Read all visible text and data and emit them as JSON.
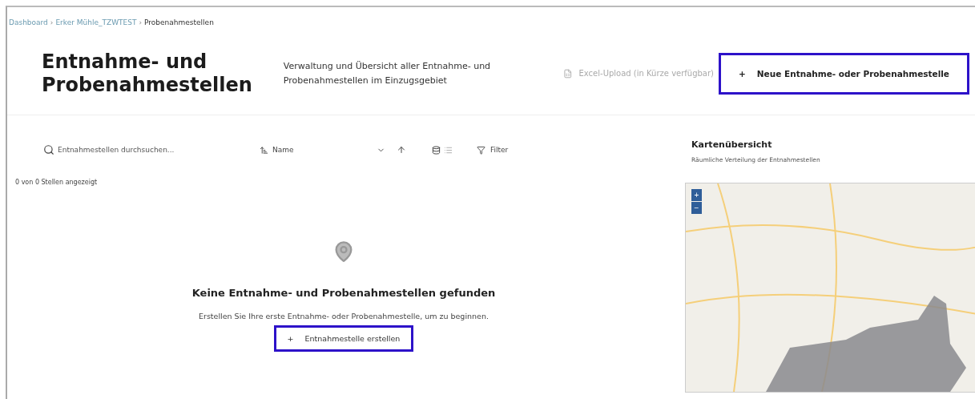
{
  "breadcrumb": {
    "separator": "›",
    "items": [
      {
        "label": "Dashboard",
        "kind": "link"
      },
      {
        "label": "Erker Mühle_TZWTEST",
        "kind": "link"
      },
      {
        "label": "Probenahmestellen",
        "kind": "current"
      }
    ]
  },
  "header": {
    "title": "Entnahme- und Probenahmestellen",
    "description": "Verwaltung und Übersicht aller Entnahme- und Probenahmestellen im Einzugsgebiet",
    "excel_upload": {
      "label": "Excel-Upload (in Kürze verfügbar)",
      "disabled": true
    },
    "new_button": {
      "icon": "+",
      "label": "Neue Entnahme- oder Probenahmestelle"
    }
  },
  "toolbar": {
    "search": {
      "placeholder": "Entnahmestellen durchsuchen..."
    },
    "sort": {
      "value": "Name"
    },
    "views": [
      {
        "kind": "grid",
        "selected": true
      },
      {
        "kind": "list",
        "selected": false
      }
    ],
    "filter": "Filter"
  },
  "count": "0 von 0 Stellen angezeigt",
  "empty": {
    "title": "Keine Entnahme- und Probenahmestellen gefunden",
    "text": "Erstellen Sie Ihre erste Entnahme- oder Probenahmestelle, um zu beginnen.",
    "button": {
      "icon": "+",
      "label": "Entnahmestelle erstellen"
    }
  },
  "map": {
    "title": "Kartenübersicht",
    "subtitle": "Räumliche Verteilung der Entnahmestellen",
    "zoom_in": "+",
    "zoom_out": "−"
  }
}
